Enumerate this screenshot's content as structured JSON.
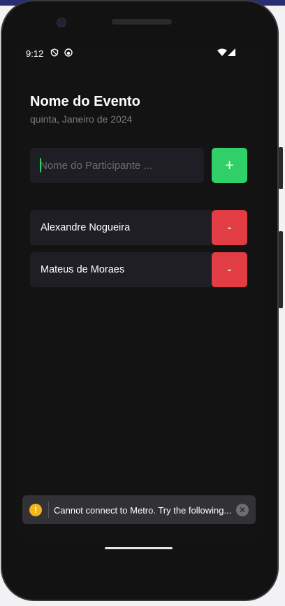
{
  "status_bar": {
    "time": "9:12",
    "icons": [
      "vpn-shield-icon",
      "app-notification-icon",
      "wifi-icon",
      "cellular-signal-icon"
    ]
  },
  "event": {
    "title": "Nome do Evento",
    "date": "quinta, Janeiro de 2024"
  },
  "form": {
    "placeholder": "Nome do Participante ...",
    "value": "",
    "add_label": "+"
  },
  "participants": [
    {
      "name": "Alexandre Nogueira",
      "remove_label": "-"
    },
    {
      "name": "Mateus de Moraes",
      "remove_label": "-"
    }
  ],
  "toast": {
    "icon_label": "!",
    "message": "Cannot connect to Metro.  Try the following...",
    "close_label": "✕"
  },
  "colors": {
    "background": "#131313",
    "card": "#1f1e25",
    "add": "#31cf67",
    "remove": "#e23c44",
    "warning": "#f5b31c"
  }
}
